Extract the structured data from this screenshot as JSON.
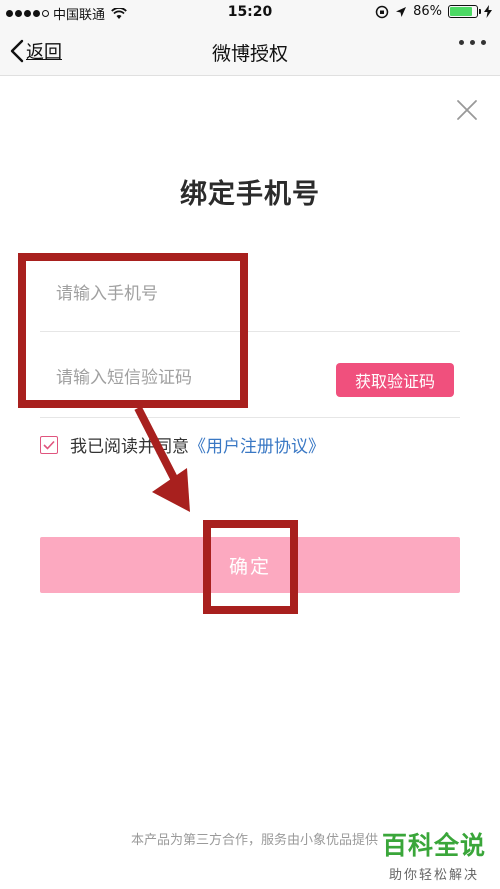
{
  "status_bar": {
    "carrier": "中国联通",
    "time": "15:20",
    "battery": "86%",
    "battery_level": 0.86,
    "battery_color": "#4cd964"
  },
  "nav": {
    "back_label": "返回",
    "title": "微博授权"
  },
  "page": {
    "title": "绑定手机号",
    "phone_placeholder": "请输入手机号",
    "code_placeholder": "请输入短信验证码",
    "get_code_label": "获取验证码",
    "agree_text": "我已阅读并同意",
    "agree_link": "《用户注册协议》",
    "confirm_label": "确定",
    "footer": "本产品为第三方合作，服务由小象优品提供"
  },
  "colors": {
    "accent": "#f0507d",
    "confirm_bg": "#fca9c0",
    "link": "#3a78c4",
    "annotation": "#a8201e"
  },
  "icons": [
    "signal-icon",
    "wifi-icon",
    "orientation-lock-icon",
    "location-icon",
    "battery-icon",
    "charging-icon",
    "back-chevron-icon",
    "more-icon",
    "close-icon",
    "checkmark-icon"
  ],
  "watermark": {
    "main": "百科全说",
    "sub": "助你轻松解决"
  }
}
